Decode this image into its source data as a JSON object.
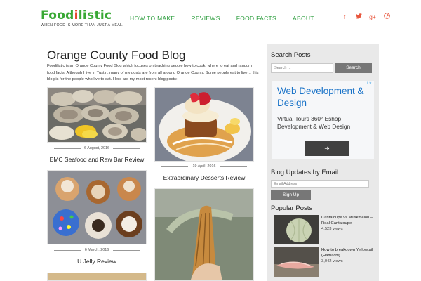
{
  "header": {
    "logo_text_a": "Food",
    "logo_text_b": "i",
    "logo_text_c": "listic",
    "tagline": "WHEN FOOD IS MORE THAN JUST A MEAL.",
    "nav": [
      "HOW TO MAKE",
      "REVIEWS",
      "FOOD FACTS",
      "ABOUT"
    ],
    "social": [
      "f",
      "t",
      "g+",
      "p"
    ],
    "accent": "#38a834",
    "social_color": "#e8573e"
  },
  "main": {
    "title": "Orange County Food Blog",
    "intro": "Foodilistic is an Orange County Food Blog which focuses on teaching people how to cook, where to eat and random food facts. Although I live in Tustin, many of my posts are from all around Orange County. Some people eat to live… this blog is for the people who live to eat. Here are my most recent blog posts:",
    "posts": [
      {
        "date": "6 August, 2016",
        "title": "EMC Seafood and Raw Bar Review"
      },
      {
        "date": "19 April, 2016",
        "title": "Extraordinary Desserts Review"
      },
      {
        "date": "6 March, 2016",
        "title": "U Jelly Review"
      }
    ]
  },
  "sidebar": {
    "search_heading": "Search Posts",
    "search_placeholder": "Search ...",
    "search_button": "Search",
    "ad": {
      "info": "i ✕",
      "title": "Web Development & Design",
      "subtitle": "Virtual Tours 360° Eshop Development & Web Design",
      "button": "➜"
    },
    "email_heading": "Blog Updates by Email",
    "email_placeholder": "Email Address",
    "signup_button": "Sign Up",
    "popular_heading": "Popular Posts",
    "popular": [
      {
        "title": "Cantaloupe vs Muskmelon – Real Cantaloupe",
        "views": "4,523 views"
      },
      {
        "title": "How to breakdown Yellowtail (Hamachi)",
        "views": "3,042 views"
      }
    ]
  }
}
